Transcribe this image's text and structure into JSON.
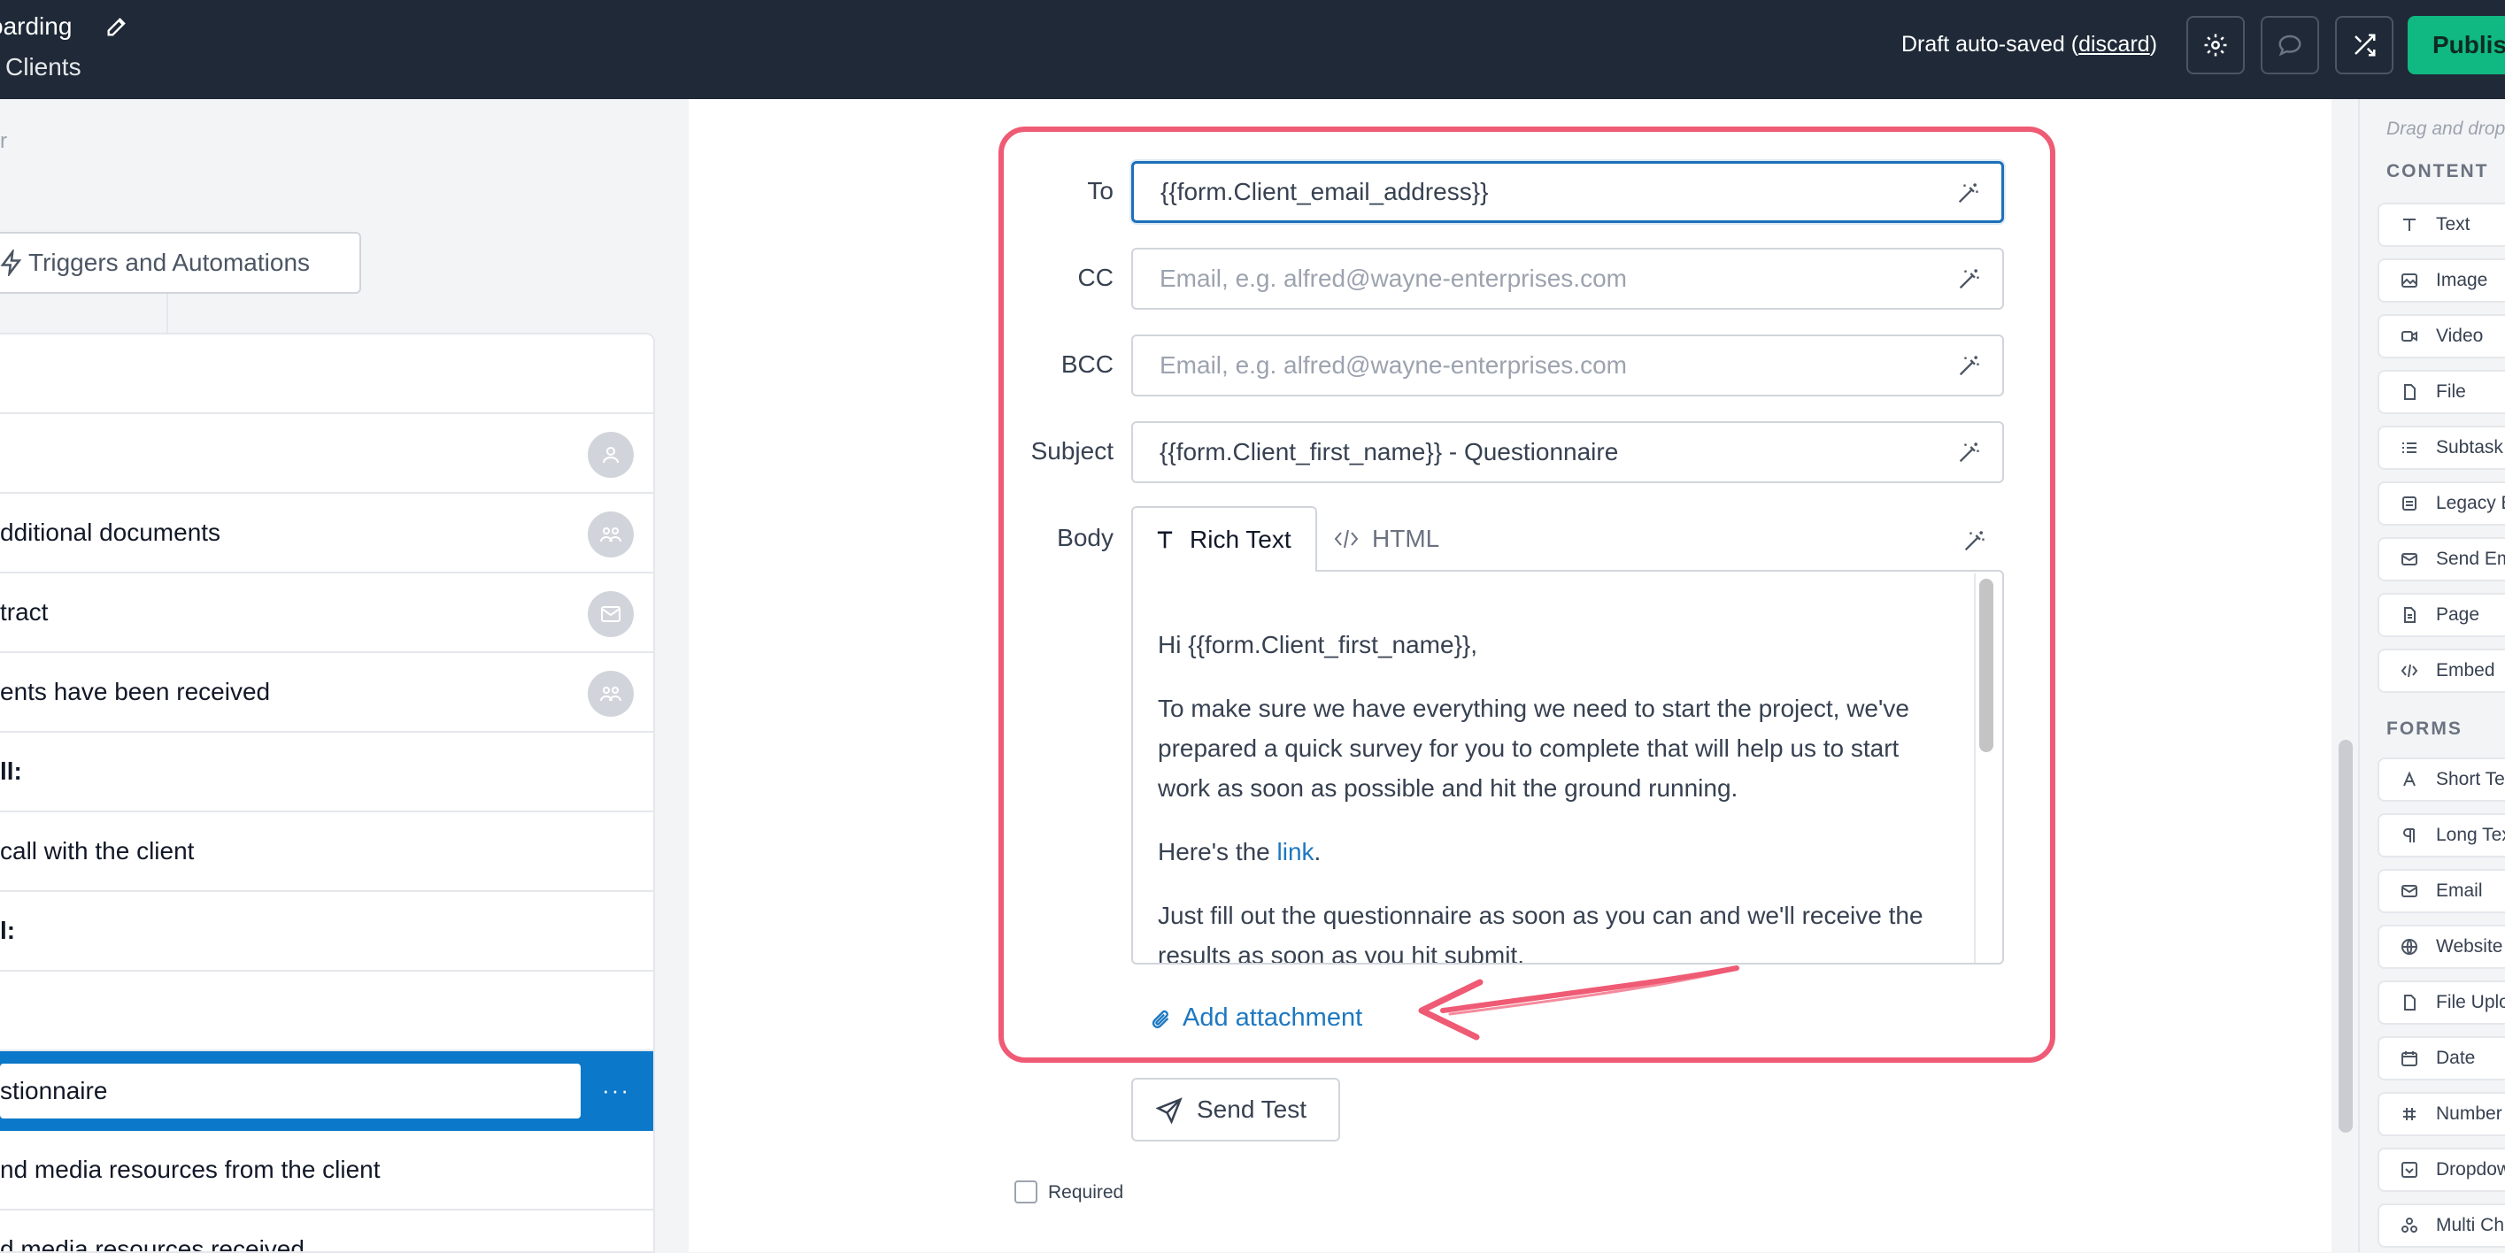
{
  "header": {
    "title": "oarding",
    "subtitle": "Clients",
    "draft_prefix": "Draft auto-saved (",
    "draft_discard": "discard",
    "draft_suffix": ")",
    "publish_label": "Publis"
  },
  "left": {
    "filter_text": "r",
    "triggers_label": "Triggers and Automations",
    "rows": [
      {
        "text": ""
      },
      {
        "text": ""
      },
      {
        "text": "dditional documents"
      },
      {
        "text": "tract"
      },
      {
        "text": "ents have been received"
      },
      {
        "text": "ll:"
      },
      {
        "text": "call with the client"
      },
      {
        "text": "l:"
      },
      {
        "text": ""
      },
      {
        "text": "stionnaire"
      },
      {
        "text": "nd media resources from the client"
      },
      {
        "text": "d media resources received"
      }
    ],
    "more_label": "···"
  },
  "email": {
    "to_label": "To",
    "to_value": "{{form.Client_email_address}}",
    "cc_label": "CC",
    "cc_placeholder": "Email, e.g. alfred@wayne-enterprises.com",
    "bcc_label": "BCC",
    "bcc_placeholder": "Email, e.g. alfred@wayne-enterprises.com",
    "subject_label": "Subject",
    "subject_value": "{{form.Client_first_name}} - Questionnaire",
    "body_label": "Body",
    "tab_rich": "Rich Text",
    "tab_html": "HTML",
    "body": {
      "greeting": "Hi {{form.Client_first_name}},",
      "p1": "To make sure we have everything we need to start the project, we've prepared a quick survey for you to complete that will help us to start work as soon as possible and hit the ground running.",
      "p2_prefix": "Here's the ",
      "p2_link": "link",
      "p2_suffix": ".",
      "p3": "Just fill out the questionnaire as soon as you can and we'll receive the results as soon as you hit submit."
    },
    "add_attachment": "Add attachment",
    "send_test": "Send Test",
    "required_label": "Required"
  },
  "palette": {
    "hint": "Drag and drop",
    "content_title": "CONTENT",
    "content_items": [
      {
        "label": "Text",
        "icon": "text-icon"
      },
      {
        "label": "Image",
        "icon": "image-icon"
      },
      {
        "label": "Video",
        "icon": "video-icon"
      },
      {
        "label": "File",
        "icon": "file-icon"
      },
      {
        "label": "Subtask",
        "icon": "subtask-icon"
      },
      {
        "label": "Legacy E",
        "icon": "legacy-icon"
      },
      {
        "label": "Send Em",
        "icon": "mail-icon"
      },
      {
        "label": "Page",
        "icon": "page-icon"
      },
      {
        "label": "Embed",
        "icon": "code-icon"
      }
    ],
    "forms_title": "FORMS",
    "forms_items": [
      {
        "label": "Short Te",
        "icon": "short-text-icon"
      },
      {
        "label": "Long Tex",
        "icon": "paragraph-icon"
      },
      {
        "label": "Email",
        "icon": "mail-icon"
      },
      {
        "label": "Website",
        "icon": "globe-icon"
      },
      {
        "label": "File Uploa",
        "icon": "file-upload-icon"
      },
      {
        "label": "Date",
        "icon": "calendar-icon"
      },
      {
        "label": "Number",
        "icon": "hash-icon"
      },
      {
        "label": "Dropdow",
        "icon": "dropdown-icon"
      },
      {
        "label": "Multi Ch",
        "icon": "multi-choice-icon"
      }
    ]
  },
  "colors": {
    "topbar": "#1f2937",
    "accent_blue": "#0b78c9",
    "callout_red": "#ef5a74",
    "publish_green": "#10b981"
  }
}
